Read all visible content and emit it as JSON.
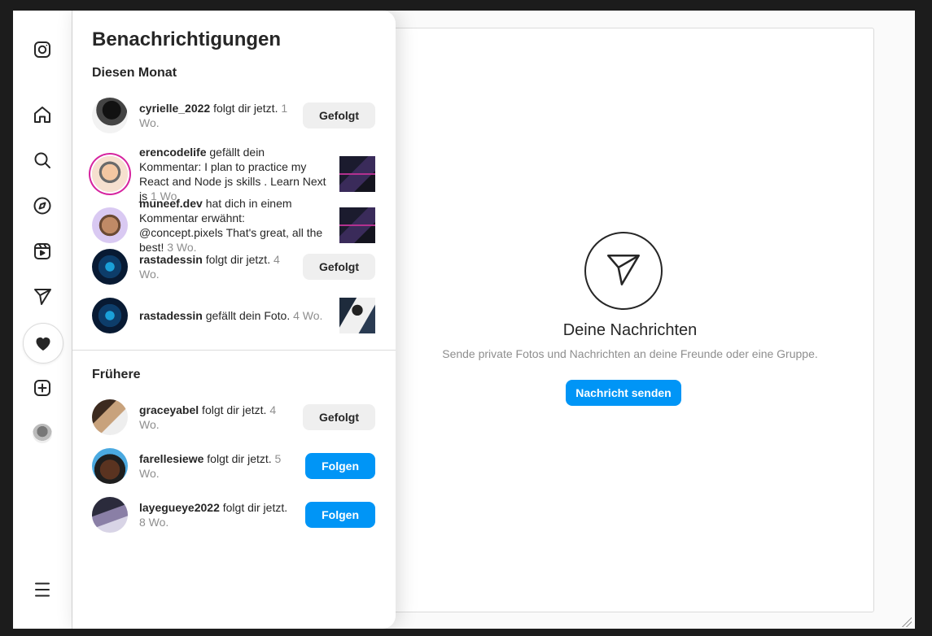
{
  "nav": {
    "items": [
      {
        "name": "instagram-icon"
      },
      {
        "name": "home-icon"
      },
      {
        "name": "search-icon"
      },
      {
        "name": "explore-icon"
      },
      {
        "name": "reels-icon"
      },
      {
        "name": "direct-icon"
      },
      {
        "name": "heart-icon",
        "active": true
      },
      {
        "name": "create-icon"
      },
      {
        "name": "profile-avatar"
      },
      {
        "name": "menu-icon"
      }
    ]
  },
  "notifications": {
    "title": "Benachrichtigungen",
    "this_month": {
      "heading": "Diesen Monat",
      "items": [
        {
          "user": "cyrielle_2022",
          "text": " folgt dir jetzt. ",
          "time": "1 Wo.",
          "action": "Gefolgt"
        },
        {
          "user": "erencodelife",
          "text": " gefällt dein Kommentar: I plan to practice my React and Node js skills . Learn Next js ",
          "time": "1 Wo."
        },
        {
          "user": "muneef.dev",
          "text": " hat dich in einem Kommentar erwähnt: @concept.pixels That's great, all the best! ",
          "time": "3 Wo."
        },
        {
          "user": "rastadessin",
          "text": " folgt dir jetzt. ",
          "time": "4 Wo.",
          "action": "Gefolgt"
        },
        {
          "user": "rastadessin",
          "text": " gefällt dein Foto. ",
          "time": "4 Wo."
        }
      ]
    },
    "earlier": {
      "heading": "Frühere",
      "items": [
        {
          "user": "graceyabel",
          "text": " folgt dir jetzt. ",
          "time": "4 Wo.",
          "action": "Gefolgt"
        },
        {
          "user": "farellesiewe",
          "text": " folgt dir jetzt. ",
          "time": "5 Wo.",
          "action": "Folgen"
        },
        {
          "user": "layegueye2022",
          "text": " folgt dir jetzt. ",
          "time": "8 Wo.",
          "action": "Folgen"
        }
      ]
    }
  },
  "messages": {
    "title": "Deine Nachrichten",
    "subtitle": "Sende private Fotos und Nachrichten an deine Freunde oder eine Gruppe.",
    "button": "Nachricht senden"
  },
  "colors": {
    "accent": "#0095f6",
    "story_ring": "#d6249f",
    "text": "#262626",
    "muted": "#8e8e8e"
  }
}
